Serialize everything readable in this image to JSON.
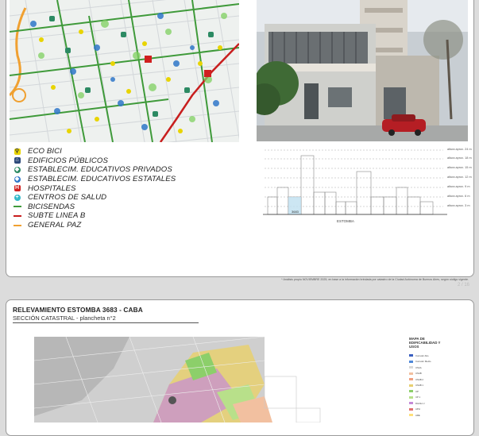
{
  "top_panel": {
    "map_name": "transport-and-services-map",
    "legend": [
      {
        "icon": "bicycle-icon",
        "label": "ECO BICI",
        "color": "#e8d400",
        "kind": "sym",
        "glyph": "⚲"
      },
      {
        "icon": "building-icon",
        "label": "EDIFICIOS PÚBLICOS",
        "color": "#2d4a7a",
        "kind": "sym",
        "glyph": "⌂"
      },
      {
        "icon": "private-school-icon",
        "label": "ESTABLECIM. EDUCATIVOS PRIVADOS",
        "color": "#2c8a63",
        "kind": "sym",
        "glyph": "◆"
      },
      {
        "icon": "state-school-icon",
        "label": "ESTABLECIM. EDUCATIVOS ESTATALES",
        "color": "#2f77c9",
        "kind": "sym",
        "glyph": "◆"
      },
      {
        "icon": "hospital-icon",
        "label": "HOSPITALES",
        "color": "#d02020",
        "kind": "sym",
        "glyph": "H"
      },
      {
        "icon": "health-center-icon",
        "label": "CENTROS DE SALUD",
        "color": "#35b9c9",
        "kind": "sym",
        "glyph": "+"
      },
      {
        "icon": "bike-lane-line-icon",
        "label": "BICISENDAS",
        "color": "#3f9a3a",
        "kind": "line"
      },
      {
        "icon": "subway-line-icon",
        "label": "SUBTE LINEA B",
        "color": "#c81e1e",
        "kind": "line"
      },
      {
        "icon": "general-paz-line-icon",
        "label": "GENERAL PAZ",
        "color": "#f0a030",
        "kind": "line"
      }
    ],
    "elevation": {
      "lot_label": "3683",
      "street_label": "ESTOMBA",
      "height_notes": [
        "altura aprox. 24 m",
        "altura aprox. 18 m",
        "altura aprox. 15 m",
        "altura aprox. 12 m",
        "altura aprox. 9 m",
        "altura aprox. 6 m",
        "altura aprox. 3 m"
      ]
    },
    "footnote": "* Análisis propio NOVIEMBRE 2025, en base a la información brindada por catastro de la Ciudad Autónoma de Buenos Aires, según código vigente.",
    "page_number": "2 / 16"
  },
  "bottom_panel": {
    "title": "RELEVAMIENTO ESTOMBA 3683 - CABA",
    "subtitle": "SECCIÓN CATASTRAL -  plancheta n°2",
    "legend_title": "MAPA DE EDIFICABILIDAD Y USOS",
    "legend_items": [
      {
        "label": "Corredor Alto",
        "color": "#3a5fc0"
      },
      {
        "label": "Corredor Medio",
        "color": "#4f88d8"
      },
      {
        "label": "USAA",
        "color": "#d8d8d8"
      },
      {
        "label": "USAB",
        "color": "#f2c0a0"
      },
      {
        "label": "USAB 2",
        "color": "#f0a080"
      },
      {
        "label": "USAB 1",
        "color": "#e8d070"
      },
      {
        "label": "UP",
        "color": "#8ccf6a"
      },
      {
        "label": "UP 1",
        "color": "#b8e08a"
      },
      {
        "label": "Distrito U",
        "color": "#c48ad8"
      },
      {
        "label": "APH",
        "color": "#e07070"
      },
      {
        "label": "ARE",
        "color": "#ffe07a"
      }
    ]
  }
}
